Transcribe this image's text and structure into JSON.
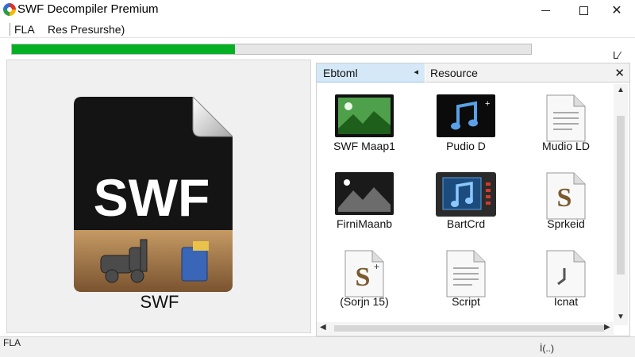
{
  "window": {
    "title": "SWF Decompiler Premium"
  },
  "menu": {
    "items": [
      "FLA",
      "Res Presurshe)"
    ]
  },
  "progress": {
    "fraction": 0.43
  },
  "right_corner_glyph": "L⁄",
  "left_panel": {
    "caption": "SWF",
    "icon_text": "SWF"
  },
  "tabs": {
    "active_label": "Ebtoml",
    "active_arrow": "◂",
    "resource_label": "Resource",
    "close_glyph": "✕"
  },
  "grid": {
    "items": [
      {
        "label": "SWF Maap1",
        "icon": "image-file-icon"
      },
      {
        "label": "Pudio D",
        "icon": "audio-file-icon"
      },
      {
        "label": "Mudio LD",
        "icon": "text-document-icon"
      },
      {
        "label": "FirniMaanb",
        "icon": "dark-image-file-icon"
      },
      {
        "label": "BartCrd",
        "icon": "music-player-icon"
      },
      {
        "label": "Sprkeid",
        "icon": "script-file-icon"
      },
      {
        "label": "(Sorjn 15)",
        "icon": "script-file-icon"
      },
      {
        "label": "Script",
        "icon": "text-document-icon"
      },
      {
        "label": "Icnat",
        "icon": "clock-document-icon"
      }
    ]
  },
  "status": {
    "left": "FLA",
    "right": "İ(..)"
  },
  "colors": {
    "progress": "#06b025",
    "tab_active": "#d5e8f8"
  }
}
